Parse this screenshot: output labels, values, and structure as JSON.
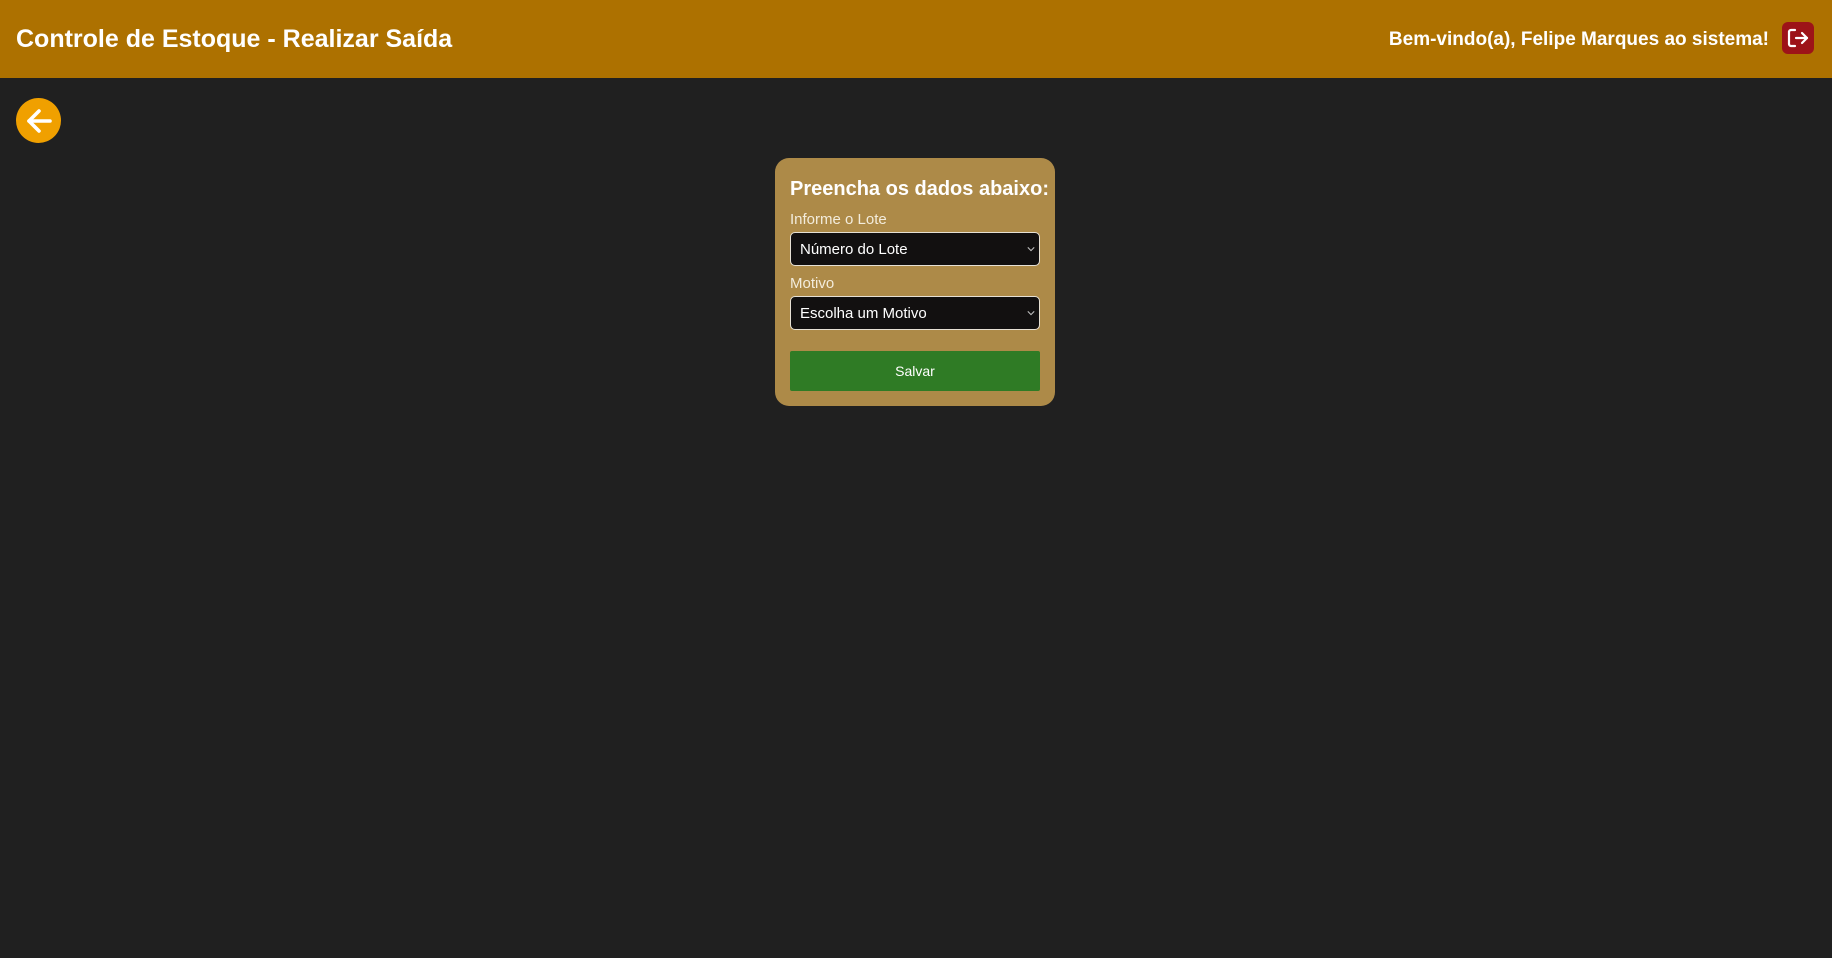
{
  "header": {
    "title": "Controle de Estoque - Realizar Saída",
    "welcome": "Bem-vindo(a), Felipe Marques ao sistema!",
    "logout_icon": "logout-icon",
    "color": "#ad7100"
  },
  "navigation": {
    "back_icon": "arrow-left-icon"
  },
  "form": {
    "title": "Preencha os dados abaixo:",
    "lote_label": "Informe o Lote",
    "lote_value": "Número do Lote",
    "motivo_label": "Motivo",
    "motivo_value": "Escolha um Motivo",
    "save_label": "Salvar"
  },
  "colors": {
    "background": "#202020",
    "card": "#ad8a48",
    "accent": "#f0a000",
    "save_button": "#2f7b25",
    "logout_button": "#9d1318"
  }
}
